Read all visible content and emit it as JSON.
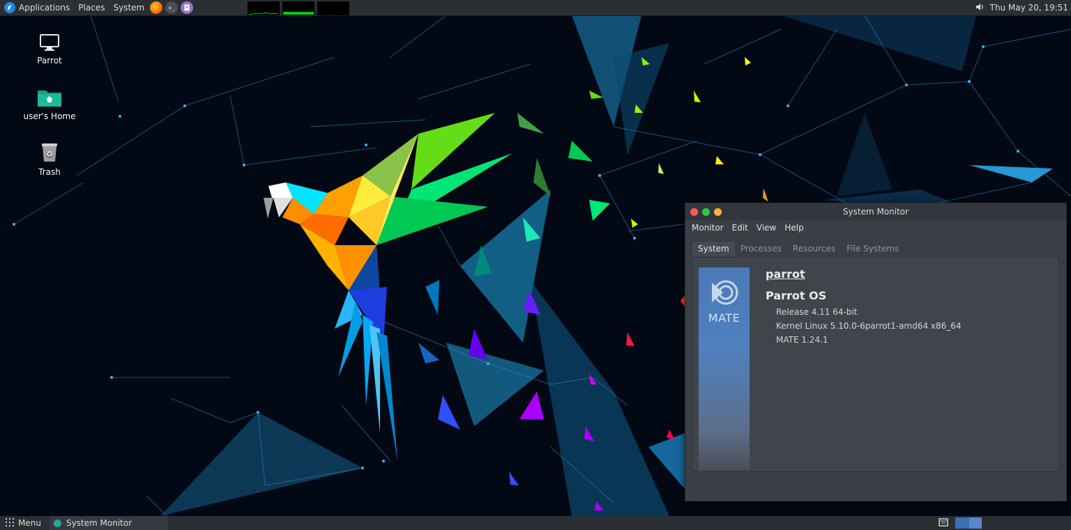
{
  "top_panel": {
    "menus": [
      "Applications",
      "Places",
      "System"
    ],
    "launchers": [
      "firefox-icon",
      "terminal-icon",
      "text-editor-icon"
    ],
    "clock": "Thu May 20, 19:51",
    "volume_icon": "volume-icon"
  },
  "desktop": {
    "icons": [
      {
        "label": "Parrot",
        "icon": "computer-icon"
      },
      {
        "label": "user's Home",
        "icon": "home-folder-icon"
      },
      {
        "label": "Trash",
        "icon": "trash-icon"
      }
    ]
  },
  "window": {
    "title": "System Monitor",
    "menu": [
      "Monitor",
      "Edit",
      "View",
      "Help"
    ],
    "tabs": [
      "System",
      "Processes",
      "Resources",
      "File Systems"
    ],
    "active_tab": "System",
    "banner_text": "MATE",
    "hostname": "parrot",
    "os_name": "Parrot OS",
    "details": [
      "Release 4.11 64-bit",
      "Kernel Linux 5.10.0-6parrot1-amd64 x86_64",
      "MATE 1.24.1"
    ]
  },
  "bottom_panel": {
    "menu_label": "Menu",
    "task_label": "System Monitor"
  },
  "colors": {
    "panel": "#2b2e33",
    "window_bg": "#3a3e45",
    "accent": "#4a7ab8",
    "close": "#fc5a54",
    "minimize": "#2bc940",
    "maximize": "#fdb732"
  }
}
